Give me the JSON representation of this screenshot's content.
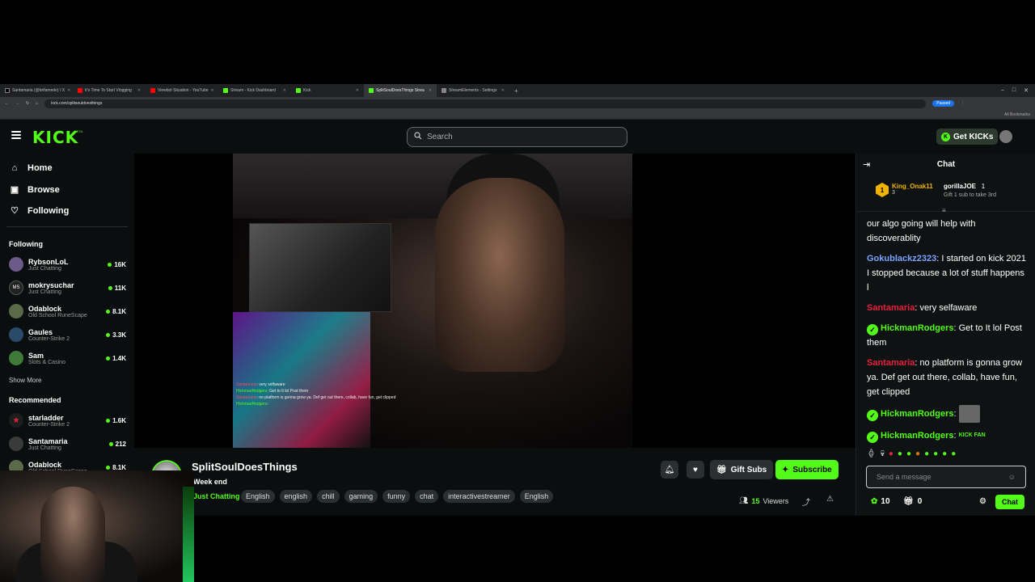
{
  "browser": {
    "tabs": [
      {
        "label": "Santamaria (@brifamedo) / X",
        "color": "#000000"
      },
      {
        "label": "It's Time To Start Vlogging",
        "color": "#ff0000"
      },
      {
        "label": "Viewbot Situation - YouTube",
        "color": "#ff0000"
      },
      {
        "label": "Stream - Kick Dashboard",
        "color": "#53fc18"
      },
      {
        "label": "Kick",
        "color": "#53fc18"
      },
      {
        "label": "SplitSoulDoesThings Strea",
        "color": "#53fc18"
      },
      {
        "label": "StreamElements - Settings",
        "color": "#888888"
      }
    ],
    "url": "kick.com/splitsouldoesthings",
    "bookmarks_label": "All Bookmarks",
    "profile_label": "Paused"
  },
  "nav": {
    "logo": "KICK",
    "logo_badge": "BETA",
    "search_placeholder": "Search",
    "get_kicks_label": "Get KICKs"
  },
  "sidebar": {
    "nav_items": [
      {
        "label": "Home",
        "icon": "home-icon"
      },
      {
        "label": "Browse",
        "icon": "browse-icon"
      },
      {
        "label": "Following",
        "icon": "heart-icon"
      }
    ],
    "following_heading": "Following",
    "following": [
      {
        "name": "RybsonLoL",
        "category": "Just Chatting",
        "viewers": "16K"
      },
      {
        "name": "mokrysuchar",
        "category": "Just Chatting",
        "viewers": "11K",
        "initials": "MS"
      },
      {
        "name": "Odablock",
        "category": "Old School RuneScape",
        "viewers": "8.1K"
      },
      {
        "name": "Gaules",
        "category": "Counter-Strike 2",
        "viewers": "3.3K"
      },
      {
        "name": "Sam",
        "category": "Slots & Casino",
        "viewers": "1.4K"
      }
    ],
    "show_more": "Show More",
    "recommended_heading": "Recommended",
    "recommended": [
      {
        "name": "starladder",
        "category": "Counter-Strike 2",
        "viewers": "1.6K"
      },
      {
        "name": "Santamaria",
        "category": "Just Chatting",
        "viewers": "212"
      },
      {
        "name": "Odablock",
        "category": "Old School RuneScape",
        "viewers": "8.1K"
      }
    ]
  },
  "video_overlay_chat": [
    {
      "user": "Santamaria",
      "text": "very selfaware",
      "color": "red"
    },
    {
      "user": "HickmanRodgers",
      "text": "Get to It lol Post them",
      "color": "green"
    },
    {
      "user": "Santamaria",
      "text": "no platform is gonna grow ya. Def get out there, collab, have fun, get clipped",
      "color": "red"
    },
    {
      "user": "HickmanRodgers",
      "text": "",
      "color": "green"
    }
  ],
  "stream": {
    "streamer": "SplitSoulDoesThings",
    "title": "Week end",
    "category": "Just Chatting",
    "tags": [
      "English",
      "english",
      "chill",
      "gaming",
      "funny",
      "chat",
      "interactivestreamer",
      "English"
    ],
    "gift_subs_label": "Gift Subs",
    "subscribe_label": "Subscribe",
    "viewer_count": "15",
    "viewers_label": "Viewers"
  },
  "chat": {
    "title": "Chat",
    "pinned": {
      "top_gifter": "King_Onak11",
      "top_gifter_rank": "1",
      "top_gifter_count": "3",
      "second_user": "gorillaJOE",
      "second_count": "1",
      "second_note": "Gift 1 sub to take 3rd"
    },
    "messages": [
      {
        "user": "",
        "text": "our algo going will help with discoverablity",
        "color": "white"
      },
      {
        "user": "Gokublackz2323",
        "text": "I started on kick 2021 I stopped because a lot of stuff happens l",
        "color": "blue"
      },
      {
        "user": "Santamaria",
        "text": "very selfaware",
        "color": "red"
      },
      {
        "user": "HickmanRodgers",
        "text": "Get to It lol Post them",
        "color": "green",
        "verified": true
      },
      {
        "user": "Santamaria",
        "text": "no platform is gonna grow ya. Def get out there, collab, have fun, get clipped",
        "color": "red"
      },
      {
        "user": "HickmanRodgers",
        "text": "",
        "color": "green",
        "verified": true,
        "emote": "image"
      },
      {
        "user": "HickmanRodgers",
        "text": "",
        "color": "green",
        "verified": true,
        "emote": "KICK FAN"
      }
    ],
    "input_placeholder": "Send a message",
    "points": "10",
    "gifts": "0",
    "chat_button": "Chat"
  },
  "colors": {
    "accent": "#53fc18",
    "background": "#0b0e0f",
    "chat_red": "#e3223d",
    "chat_blue": "#7aa2ff",
    "gold": "#f0b400"
  }
}
